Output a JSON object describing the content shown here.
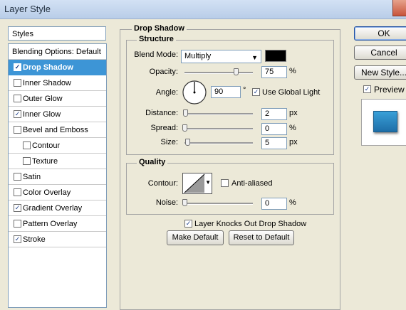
{
  "window": {
    "title": "Layer Style"
  },
  "styles": {
    "header": "Styles",
    "items": [
      {
        "label": "Blending Options: Default",
        "checkbox": false,
        "checked": false,
        "indent": false,
        "selected": false
      },
      {
        "label": "Drop Shadow",
        "checkbox": true,
        "checked": true,
        "indent": false,
        "selected": true
      },
      {
        "label": "Inner Shadow",
        "checkbox": true,
        "checked": false,
        "indent": false,
        "selected": false
      },
      {
        "label": "Outer Glow",
        "checkbox": true,
        "checked": false,
        "indent": false,
        "selected": false
      },
      {
        "label": "Inner Glow",
        "checkbox": true,
        "checked": true,
        "indent": false,
        "selected": false
      },
      {
        "label": "Bevel and Emboss",
        "checkbox": true,
        "checked": false,
        "indent": false,
        "selected": false
      },
      {
        "label": "Contour",
        "checkbox": true,
        "checked": false,
        "indent": true,
        "selected": false
      },
      {
        "label": "Texture",
        "checkbox": true,
        "checked": false,
        "indent": true,
        "selected": false
      },
      {
        "label": "Satin",
        "checkbox": true,
        "checked": false,
        "indent": false,
        "selected": false
      },
      {
        "label": "Color Overlay",
        "checkbox": true,
        "checked": false,
        "indent": false,
        "selected": false
      },
      {
        "label": "Gradient Overlay",
        "checkbox": true,
        "checked": true,
        "indent": false,
        "selected": false
      },
      {
        "label": "Pattern Overlay",
        "checkbox": true,
        "checked": false,
        "indent": false,
        "selected": false
      },
      {
        "label": "Stroke",
        "checkbox": true,
        "checked": true,
        "indent": false,
        "selected": false
      }
    ]
  },
  "drop_shadow": {
    "title": "Drop Shadow",
    "structure": {
      "title": "Structure",
      "blend_mode_label": "Blend Mode:",
      "blend_mode_value": "Multiply",
      "shadow_color": "#000000",
      "opacity_label": "Opacity:",
      "opacity_value": "75",
      "opacity_unit": "%",
      "opacity_level": 0.75,
      "angle_label": "Angle:",
      "angle_value": "90",
      "angle_unit": "°",
      "use_global_light_label": "Use Global Light",
      "use_global_light": true,
      "distance_label": "Distance:",
      "distance_value": "2",
      "distance_unit": "px",
      "spread_label": "Spread:",
      "spread_value": "0",
      "spread_unit": "%",
      "size_label": "Size:",
      "size_value": "5",
      "size_unit": "px"
    },
    "quality": {
      "title": "Quality",
      "contour_label": "Contour:",
      "anti_aliased_label": "Anti-aliased",
      "anti_aliased": false,
      "noise_label": "Noise:",
      "noise_value": "0",
      "noise_unit": "%"
    },
    "layer_knocks_out_label": "Layer Knocks Out Drop Shadow",
    "layer_knocks_out": true,
    "make_default_label": "Make Default",
    "reset_default_label": "Reset to Default"
  },
  "buttons": {
    "ok": "OK",
    "cancel": "Cancel",
    "new_style": "New Style...",
    "preview_label": "Preview",
    "preview_checked": true
  },
  "colors": {
    "selection": "#3d95d6",
    "preview_swatch": "#3aa0d8"
  }
}
